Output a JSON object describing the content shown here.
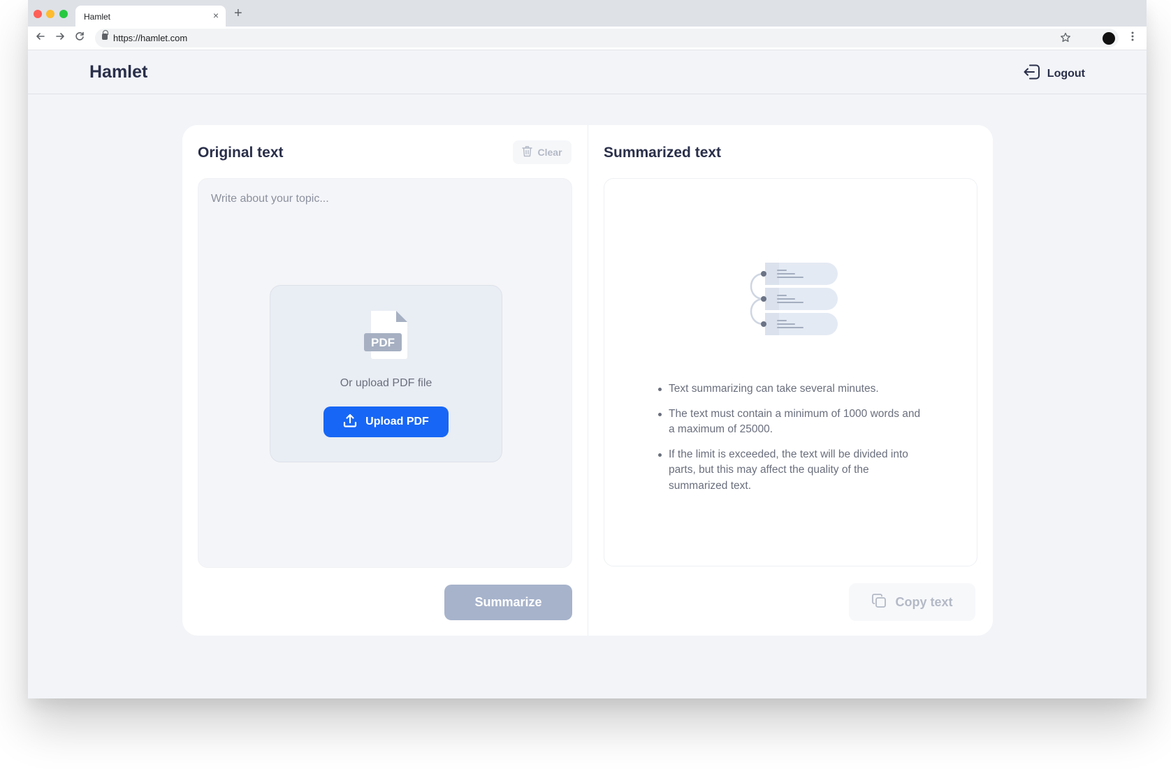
{
  "browser": {
    "tab_title": "Hamlet",
    "tab_close": "×",
    "new_tab": "+",
    "url": "https://hamlet.com",
    "icons": [
      "back-arrow-icon",
      "forward-arrow-icon",
      "reload-icon",
      "lock-icon",
      "star-icon",
      "profile-icon",
      "kebab-menu-icon"
    ]
  },
  "header": {
    "brand": "Hamlet",
    "logout_label": "Logout"
  },
  "original_panel": {
    "title": "Original text",
    "clear_label": "Clear",
    "textarea_placeholder": "Write about your topic...",
    "pdf_badge": "PDF",
    "upload_hint": "Or upload PDF file",
    "upload_button_label": "Upload PDF",
    "summarize_button_label": "Summarize"
  },
  "summary_panel": {
    "title": "Summarized text",
    "notes": [
      "Text summarizing can take several minutes.",
      "The text must contain a minimum of 1000 words and a maximum of 25000.",
      "If the limit is exceeded, the text will be divided into parts, but this may affect the quality of the summarized text."
    ],
    "copy_button_label": "Copy text"
  },
  "colors": {
    "accent": "#1766f5",
    "disabled_button": "#a7b3cb",
    "page_background": "#f2f4f8",
    "heading_text": "#2a2f4a"
  }
}
